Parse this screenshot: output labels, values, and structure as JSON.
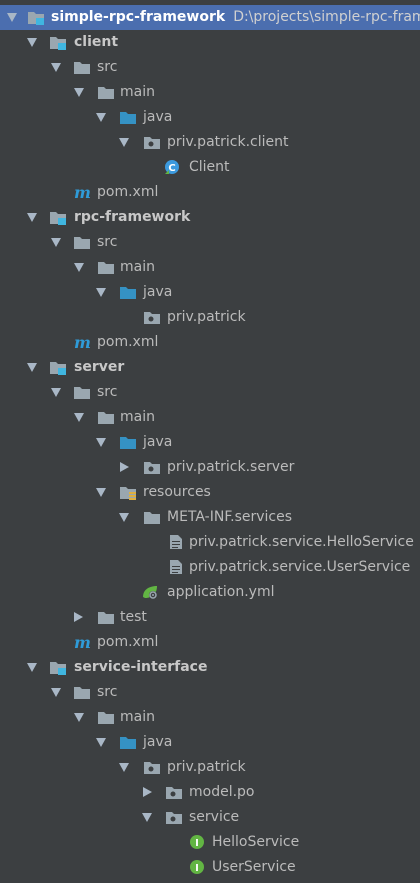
{
  "project": {
    "root": {
      "name": "simple-rpc-framework",
      "path": "D:\\projects\\simple-rpc-framew"
    },
    "client": {
      "name": "client",
      "src": "src",
      "main": "main",
      "java": "java",
      "package": "priv.patrick.client",
      "class": "Client",
      "pom": "pom.xml"
    },
    "rpc_framework": {
      "name": "rpc-framework",
      "src": "src",
      "main": "main",
      "java": "java",
      "package": "priv.patrick",
      "pom": "pom.xml"
    },
    "server": {
      "name": "server",
      "src": "src",
      "main": "main",
      "java": "java",
      "package": "priv.patrick.server",
      "resources": "resources",
      "meta_inf": "META-INF.services",
      "file1": "priv.patrick.service.HelloService",
      "file2": "priv.patrick.service.UserService",
      "yml": "application.yml",
      "test": "test",
      "pom": "pom.xml"
    },
    "service_interface": {
      "name": "service-interface",
      "src": "src",
      "main": "main",
      "java": "java",
      "package": "priv.patrick",
      "model": "model.po",
      "service": "service",
      "iface1": "HelloService",
      "iface2": "UserService"
    }
  },
  "colors": {
    "background": "#3c3f41",
    "selection": "#4b6eaf",
    "text": "#bbbbbb",
    "folder": "#9aa7b0",
    "source_folder": "#3592c4",
    "module_badge": "#40b6e0",
    "interface_green": "#62b543",
    "class_blue": "#3c9ade",
    "maven_blue": "#2f9bd8"
  }
}
